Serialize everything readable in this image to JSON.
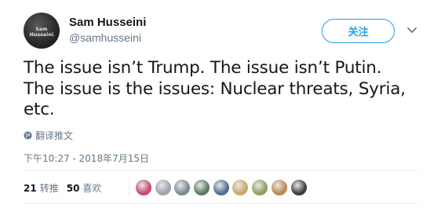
{
  "user": {
    "name": "Sam Husseini",
    "handle": "@samhusseini",
    "avatar_text": "Sam Husseini",
    "avatar_subtext": "www.samhusseini.org"
  },
  "follow_button": {
    "label": "关注"
  },
  "icons": {
    "menu": "chevron-down-icon",
    "translate": "globe-icon"
  },
  "tweet": {
    "lines": [
      "The issue isn’t Trump. The issue isn’t Putin.",
      "The issue is the issues: Nuclear threats, Syria,",
      "etc."
    ]
  },
  "translate": {
    "label": "翻译推文"
  },
  "timestamp": "下午10:27 - 2018年7月15日",
  "stats": {
    "retweets_count": "21",
    "retweets_label": "转推",
    "likes_count": "50",
    "likes_label": "喜欢"
  },
  "likers": [
    {
      "color": "#c44a6a"
    },
    {
      "color": "#9aa4ad"
    },
    {
      "color": "#7a8a8f"
    },
    {
      "color": "#5b7a5e"
    },
    {
      "color": "#4f6f8f"
    },
    {
      "color": "#c9a86a"
    },
    {
      "color": "#8aa060"
    },
    {
      "color": "#b98a52"
    },
    {
      "color": "#3d3d3d"
    }
  ],
  "colors": {
    "accent": "#1da1f2",
    "text": "#14171a",
    "muted": "#657786",
    "divider": "#e6ecf0"
  }
}
